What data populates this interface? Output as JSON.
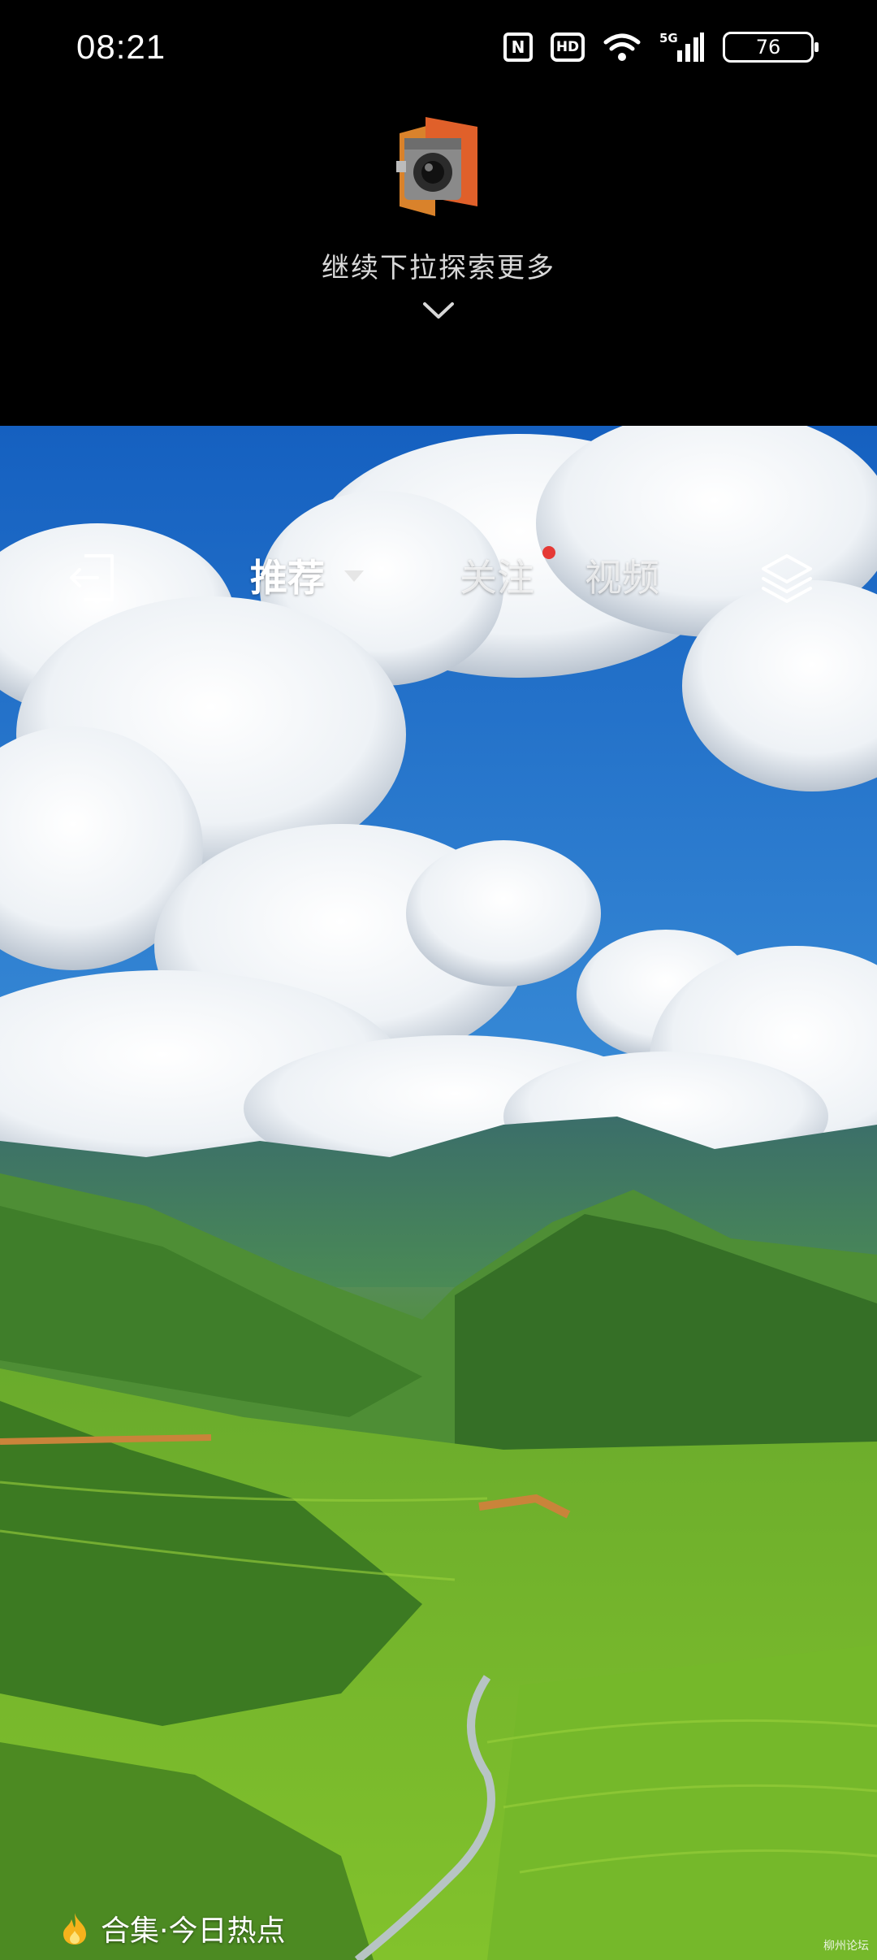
{
  "status_bar": {
    "time": "08:21",
    "nfc_label": "N",
    "hd_label": "HD",
    "network_label": "5G",
    "battery": "76",
    "icons": [
      "nfc-icon",
      "hd-icon",
      "wifi-icon",
      "signal-5g-icon",
      "battery-icon"
    ]
  },
  "pull_area": {
    "hint": "继续下拉探索更多",
    "icons": [
      "camera-logo-icon",
      "chevron-down-icon"
    ]
  },
  "nav": {
    "tabs": [
      {
        "label": "推荐",
        "active": true
      },
      {
        "label": "关注",
        "active": false,
        "has_dot": true
      },
      {
        "label": "视频",
        "active": false
      }
    ],
    "icons": [
      "exit-icon",
      "layers-icon"
    ],
    "dot_color": "#e53935"
  },
  "collection": {
    "label": "合集·今日热点",
    "icon": "flame-icon"
  },
  "watermark": "柳州论坛"
}
